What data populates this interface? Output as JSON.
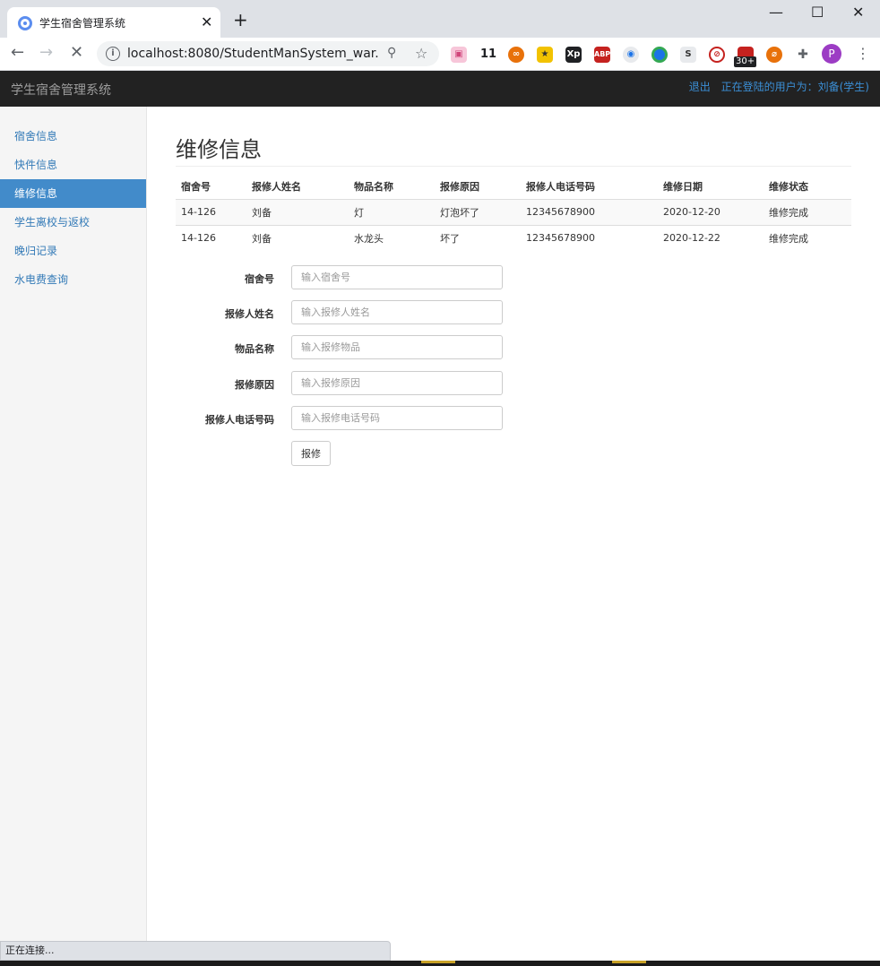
{
  "browser": {
    "tab_title": "学生宿舍管理系统",
    "tab_close": "✕",
    "new_tab": "+",
    "minimize": "—",
    "maximize": "☐",
    "close": "✕",
    "url": "localhost:8080/StudentManSystem_war...",
    "back": "←",
    "forward": "→",
    "reload": "✕",
    "star": "☆",
    "zoom": "⚲",
    "info": "i",
    "ext_badge_11": "11",
    "ext_badge_30": "30+",
    "profile_letter": "P",
    "menu": "⋮"
  },
  "navbar": {
    "brand": "学生宿舍管理系统",
    "logout": "退出",
    "user_label": "正在登陆的用户为：刘备(学生)"
  },
  "sidebar": {
    "items": [
      {
        "label": "宿舍信息"
      },
      {
        "label": "快件信息"
      },
      {
        "label": "维修信息"
      },
      {
        "label": "学生离校与返校"
      },
      {
        "label": "晚归记录"
      },
      {
        "label": "水电费查询"
      }
    ]
  },
  "main": {
    "title": "维修信息",
    "columns": [
      "宿舍号",
      "报修人姓名",
      "物品名称",
      "报修原因",
      "报修人电话号码",
      "维修日期",
      "维修状态"
    ],
    "rows": [
      [
        "14-126",
        "刘备",
        "灯",
        "灯泡坏了",
        "12345678900",
        "2020-12-20",
        "维修完成"
      ],
      [
        "14-126",
        "刘备",
        "水龙头",
        "坏了",
        "12345678900",
        "2020-12-22",
        "维修完成"
      ]
    ],
    "form": {
      "dorm_label": "宿舍号",
      "dorm_placeholder": "输入宿舍号",
      "name_label": "报修人姓名",
      "name_placeholder": "输入报修人姓名",
      "item_label": "物品名称",
      "item_placeholder": "输入报修物品",
      "reason_label": "报修原因",
      "reason_placeholder": "输入报修原因",
      "phone_label": "报修人电话号码",
      "phone_placeholder": "输入报修电话号码",
      "submit_label": "报修"
    }
  },
  "status_text": "正在连接..."
}
